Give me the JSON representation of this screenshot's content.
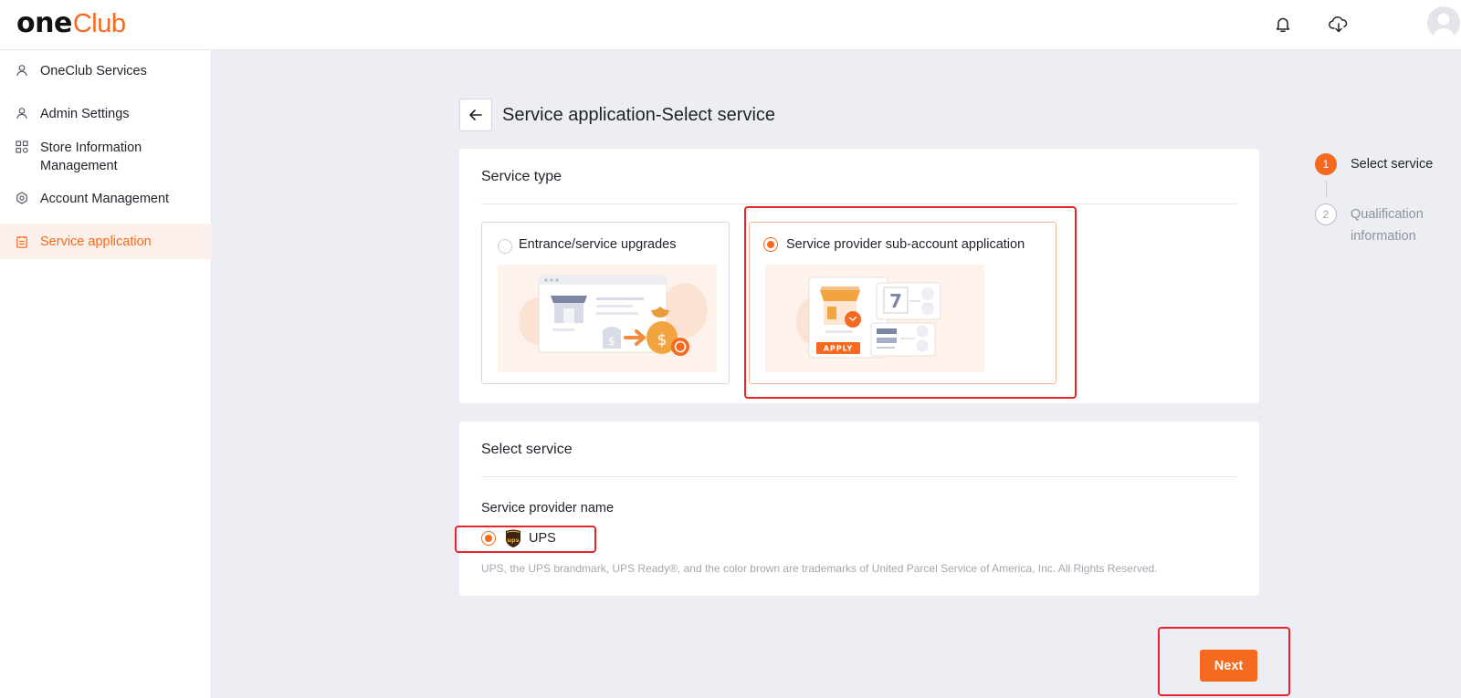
{
  "header": {
    "logo_one": "one",
    "logo_club": "Club",
    "bell_icon": "bell-icon",
    "download_icon": "cloud-download-icon",
    "avatar_icon": "user-avatar"
  },
  "sidebar": {
    "items": [
      {
        "label": "OneClub Services",
        "icon": "user-icon",
        "active": false
      },
      {
        "label": "Admin Settings",
        "icon": "user-icon",
        "active": false
      },
      {
        "label": "Store Information Management",
        "icon": "grid-icon",
        "active": false
      },
      {
        "label": "Account Management",
        "icon": "settings-icon",
        "active": false
      },
      {
        "label": "Service application",
        "icon": "clipboard-icon",
        "active": true
      }
    ]
  },
  "page": {
    "title": "Service application-Select service",
    "back_icon": "arrow-left-icon"
  },
  "service_type": {
    "title": "Service type",
    "options": [
      {
        "label": "Entrance/service upgrades",
        "selected": false
      },
      {
        "label": "Service provider sub-account application",
        "selected": true
      }
    ],
    "apply_badge": "APPLY"
  },
  "select_service": {
    "title": "Select service",
    "field_label": "Service provider name",
    "provider": {
      "label": "UPS",
      "selected": true,
      "logo_text": "ups"
    },
    "trademark": "UPS, the UPS brandmark, UPS Ready®, and the color brown are trademarks of United Parcel Service of America, Inc. All Rights Reserved."
  },
  "stepper": {
    "steps": [
      {
        "num": "1",
        "label": "Select service",
        "state": "current"
      },
      {
        "num": "2",
        "label": "Qualification information",
        "state": "pending"
      }
    ]
  },
  "actions": {
    "next_label": "Next"
  },
  "colors": {
    "accent": "#f56a1f",
    "annotation": "#e5252a",
    "ups_brown": "#3d2413",
    "ups_gold": "#f2b418"
  }
}
